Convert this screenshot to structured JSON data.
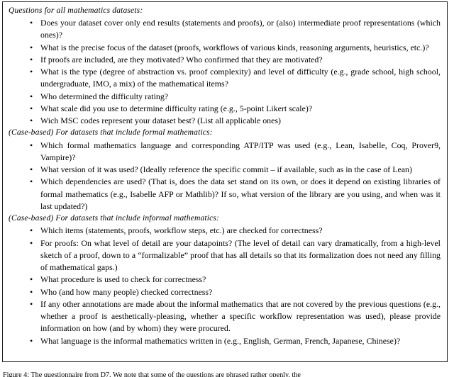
{
  "document": {
    "type": "paper-figure",
    "figure_box": {
      "sections": [
        {
          "heading": "Questions for all mathematics datasets:",
          "items": [
            "Does your dataset cover only end results (statements and proofs), or (also) intermediate proof rep­resentations (which ones)?",
            "What is the precise focus of the dataset (proofs, workflows of various kinds, reasoning arguments, heuristics, etc.)?",
            "If proofs are included, are they motivated? Who confirmed that they are motivated?",
            "What is the type (degree of abstraction vs. proof complexity) and level of difficulty (e.g., grade school, high school, undergraduate, IMO, a mix) of the mathematical items?",
            "Who determined the difficulty rating?",
            "What scale did you use to determine difficulty rating (e.g., 5-point Likert scale)?",
            "Wich MSC codes represent your dataset best? (List all applicable ones)"
          ]
        },
        {
          "heading": "(Case-based) For datasets that include formal mathematics:",
          "items": [
            "Which formal mathematics language and corresponding ATP/ITP was used (e.g., Lean, Isabelle, Coq, Prover9, Vampire)?",
            "What version of it was used? (Ideally reference the specific commit – if available, such as in the case of Lean)",
            "Which dependencies are used? (That is, does the data set stand on its own, or does it depend on existing libraries of formal mathematics (e.g., Isabelle AFP or Mathlib)? If so, what version of the library are you using, and when was it last updated?)"
          ]
        },
        {
          "heading": "(Case-based) For datasets that include informal mathematics:",
          "items": [
            "Which items (statements, proofs, workflow steps, etc.) are checked for correctness?",
            "For proofs: On what level of detail are your datapoints? (The level of detail can vary dramatically, from a high-level sketch of a proof, down to a “formalizable” proof that has all details so that its formalization does not need any filling of mathematical gaps.)",
            "What procedure is used to check for correctness?",
            "Who (and how many people) checked correctness?",
            "If any other annotations are made about the informal mathematics that are not covered by the previous questions (e.g., whether a proof is aesthetically-pleasing, whether a specific workflow repre­sentation was used), please provide information on how (and by whom) they were procured.",
            "What language is the informal mathematics written in (e.g., English, German, French, Japanese, Chinese)?"
          ]
        }
      ],
      "bullet_glyph": "•",
      "border_color": "#1a1a1a",
      "background_color": "#ffffff",
      "text_color": "#000000"
    },
    "caption": {
      "text": "Figure 4: The questionnaire from D7. We note that some of the questions are phrased rather openly, the"
    }
  }
}
